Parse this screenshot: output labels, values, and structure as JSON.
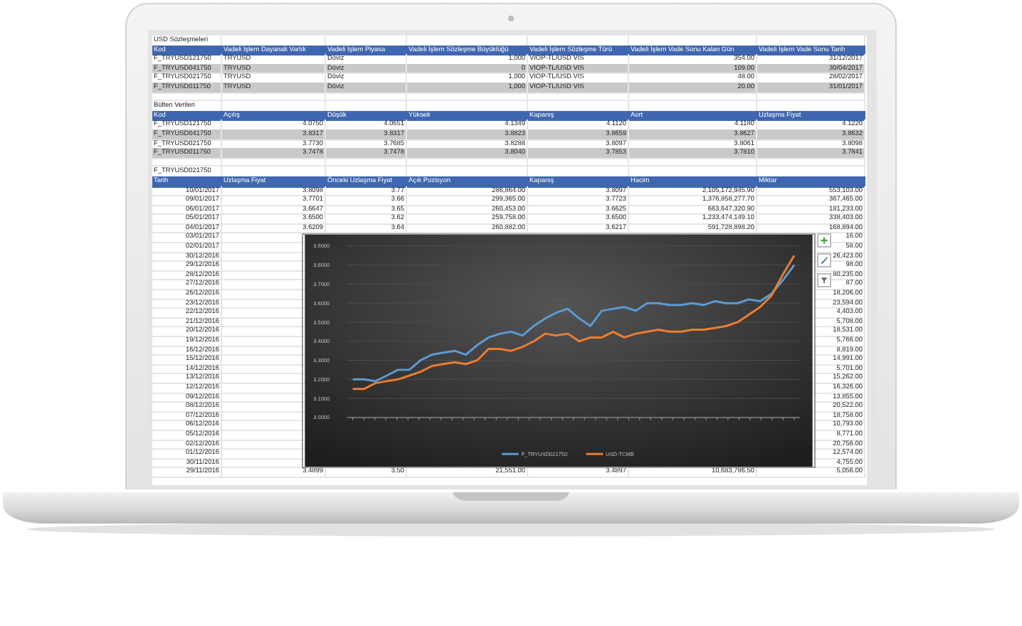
{
  "sheet": {
    "sections": [
      {
        "title": "USD Sözleşmeleri",
        "banded": true,
        "columns": [
          {
            "label": "Kod",
            "kind": "text"
          },
          {
            "label": "Vadeli İşlem Dayanak Varlık",
            "kind": "text"
          },
          {
            "label": "Vadeli İşlem Piyasa",
            "kind": "text"
          },
          {
            "label": "Vadeli İşlem Sözleşme Büyüklüğü",
            "kind": "number"
          },
          {
            "label": "Vadeli İşlem Sözleşme Türü",
            "kind": "text"
          },
          {
            "label": "Vadeli İşlem Vade Sonu Kalan Gün",
            "kind": "number"
          },
          {
            "label": "Vadeli İşlem Vade Sonu Tarih",
            "kind": "number"
          }
        ],
        "rows": [
          [
            "F_TRYUSD121750",
            "TRYUSD",
            "Döviz",
            "1,000",
            "VIOP-TL/USD VIS",
            "354.00",
            "31/12/2017"
          ],
          [
            "F_TRYUSD041750",
            "TRYUSD",
            "Döviz",
            "0",
            "VIOP-TL/USD VIS",
            "109.00",
            "30/04/2017"
          ],
          [
            "F_TRYUSD021750",
            "TRYUSD",
            "Döviz",
            "1,000",
            "VIOP-TL/USD VIS",
            "48.00",
            "28/02/2017"
          ],
          [
            "F_TRYUSD011750",
            "TRYUSD",
            "Döviz",
            "1,000",
            "VIOP-TL/USD VIS",
            "20.00",
            "31/01/2017"
          ]
        ]
      },
      {
        "title": "Bülten Verileri",
        "banded": true,
        "columns": [
          {
            "label": "Kod",
            "kind": "text"
          },
          {
            "label": "Açılış",
            "kind": "number"
          },
          {
            "label": "Düşük",
            "kind": "number"
          },
          {
            "label": "Yüksek",
            "kind": "number"
          },
          {
            "label": "Kapanış",
            "kind": "number"
          },
          {
            "label": "Aort",
            "kind": "number"
          },
          {
            "label": "Uzlaşma Fiyat",
            "kind": "number"
          }
        ],
        "rows": [
          [
            "F_TRYUSD121750",
            "4.0750",
            "4.0651",
            "4.1349",
            "4.1120",
            "4.1180",
            "4.1220"
          ],
          [
            "F_TRYUSD041750",
            "3.8317",
            "3.8317",
            "3.8823",
            "3.8659",
            "3.8627",
            "3.8632"
          ],
          [
            "F_TRYUSD021750",
            "3.7730",
            "3.7685",
            "3.8288",
            "3.8097",
            "3.8061",
            "3.8098"
          ],
          [
            "F_TRYUSD011750",
            "3.7478",
            "3.7478",
            "3.8040",
            "3.7853",
            "3.7810",
            "3.7841"
          ]
        ]
      },
      {
        "title": "F_TRYUSD021750",
        "banded": false,
        "columns": [
          {
            "label": "Tarih",
            "kind": "number"
          },
          {
            "label": "Uzlaşma Fiyat",
            "kind": "number"
          },
          {
            "label": "Önceki Uzlaşma Fiyat",
            "kind": "number"
          },
          {
            "label": "Açık Pozisyon",
            "kind": "number"
          },
          {
            "label": "Kapanış",
            "kind": "number"
          },
          {
            "label": "Hacim",
            "kind": "number"
          },
          {
            "label": "Miktar",
            "kind": "number"
          }
        ],
        "rows": [
          [
            "10/01/2017",
            "3.8098",
            "3.77",
            "286,864.00",
            "3.8097",
            "2,105,172,945.90",
            "553,103.00"
          ],
          [
            "09/01/2017",
            "3.7701",
            "3.66",
            "299,365.00",
            "3.7723",
            "1,376,858,277.70",
            "367,465.00"
          ],
          [
            "06/01/2017",
            "3.6647",
            "3.65",
            "260,453.00",
            "3.6625",
            "663,647,320.90",
            "181,233.00"
          ],
          [
            "05/01/2017",
            "3.6500",
            "3.62",
            "259,758.00",
            "3.6500",
            "1,233,474,149.10",
            "338,403.00"
          ],
          [
            "04/01/2017",
            "3.6209",
            "3.64",
            "260,882.00",
            "3.6217",
            "591,728,898.20",
            "168,894.00"
          ],
          [
            "03/01/2017",
            null,
            null,
            null,
            null,
            null,
            "16.00"
          ],
          [
            "02/01/2017",
            null,
            null,
            null,
            null,
            null,
            "58.00"
          ],
          [
            "30/12/2016",
            null,
            null,
            null,
            null,
            null,
            "26,423.00"
          ],
          [
            "29/12/2016",
            null,
            null,
            null,
            null,
            null,
            "98.00"
          ],
          [
            "28/12/2016",
            null,
            null,
            null,
            null,
            null,
            "80,235.00"
          ],
          [
            "27/12/2016",
            null,
            null,
            null,
            null,
            null,
            "87.00"
          ],
          [
            "26/12/2016",
            null,
            null,
            null,
            null,
            null,
            "18,206.00"
          ],
          [
            "23/12/2016",
            null,
            null,
            null,
            null,
            null,
            "23,594.00"
          ],
          [
            "22/12/2016",
            null,
            null,
            null,
            null,
            null,
            "4,403.00"
          ],
          [
            "21/12/2016",
            null,
            null,
            null,
            null,
            null,
            "5,708.00"
          ],
          [
            "20/12/2016",
            null,
            null,
            null,
            null,
            null,
            "18,531.00"
          ],
          [
            "19/12/2016",
            null,
            null,
            null,
            null,
            null,
            "5,766.00"
          ],
          [
            "16/12/2016",
            null,
            null,
            null,
            null,
            null,
            "8,819.00"
          ],
          [
            "15/12/2016",
            null,
            null,
            null,
            null,
            null,
            "14,991.00"
          ],
          [
            "14/12/2016",
            null,
            null,
            null,
            null,
            null,
            "5,701.00"
          ],
          [
            "13/12/2016",
            null,
            null,
            null,
            null,
            null,
            "15,262.00"
          ],
          [
            "12/12/2016",
            null,
            null,
            null,
            null,
            null,
            "16,326.00"
          ],
          [
            "09/12/2016",
            null,
            null,
            null,
            null,
            null,
            "13,855.00"
          ],
          [
            "08/12/2016",
            null,
            null,
            null,
            null,
            null,
            "20,522.00"
          ],
          [
            "07/12/2016",
            null,
            null,
            null,
            null,
            null,
            "18,758.00"
          ],
          [
            "06/12/2016",
            null,
            null,
            null,
            null,
            null,
            "10,793.00"
          ],
          [
            "05/12/2016",
            null,
            null,
            null,
            null,
            null,
            "8,771.00"
          ],
          [
            "02/12/2016",
            null,
            null,
            null,
            null,
            null,
            "20,756.00"
          ],
          [
            "01/12/2016",
            null,
            null,
            null,
            null,
            null,
            "12,574.00"
          ],
          [
            "30/11/2016",
            null,
            null,
            null,
            null,
            null,
            "4,755.00"
          ],
          [
            "29/11/2016",
            "3.4899",
            "3.50",
            "21,551.00",
            "3.4897",
            "10,683,786.50",
            "5,056.00"
          ]
        ]
      }
    ]
  },
  "chart": {
    "chart_data": {
      "type": "line",
      "ylim": [
        3.0,
        3.9
      ],
      "grid": true,
      "legend": true,
      "yticks": [
        {
          "value": 3.0,
          "label": "3.0000"
        },
        {
          "value": 3.1,
          "label": "3.1000"
        },
        {
          "value": 3.2,
          "label": "3.2000"
        },
        {
          "value": 3.3,
          "label": "3.3000"
        },
        {
          "value": 3.4,
          "label": "3.4000"
        },
        {
          "value": 3.5,
          "label": "3.5000"
        },
        {
          "value": 3.6,
          "label": "3.6000"
        },
        {
          "value": 3.7,
          "label": "3.7000"
        },
        {
          "value": 3.8,
          "label": "3.8000"
        },
        {
          "value": 3.9,
          "label": "3.9000"
        }
      ],
      "series": [
        {
          "name": "F_TRYUSD021750",
          "color": "#5b9bd5",
          "values": [
            3.2,
            3.2,
            3.19,
            3.22,
            3.25,
            3.25,
            3.3,
            3.33,
            3.34,
            3.35,
            3.33,
            3.38,
            3.42,
            3.44,
            3.45,
            3.43,
            3.48,
            3.52,
            3.55,
            3.57,
            3.52,
            3.48,
            3.56,
            3.57,
            3.58,
            3.56,
            3.6,
            3.6,
            3.59,
            3.59,
            3.6,
            3.59,
            3.61,
            3.6,
            3.6,
            3.62,
            3.61,
            3.65,
            3.72,
            3.8
          ]
        },
        {
          "name": "USD-TCMB",
          "color": "#ed7d31",
          "values": [
            3.15,
            3.15,
            3.18,
            3.19,
            3.2,
            3.22,
            3.24,
            3.27,
            3.28,
            3.29,
            3.28,
            3.3,
            3.36,
            3.36,
            3.35,
            3.37,
            3.4,
            3.44,
            3.43,
            3.44,
            3.4,
            3.42,
            3.42,
            3.45,
            3.42,
            3.44,
            3.45,
            3.46,
            3.45,
            3.45,
            3.46,
            3.46,
            3.47,
            3.48,
            3.5,
            3.54,
            3.58,
            3.64,
            3.75,
            3.85
          ]
        }
      ]
    },
    "tools": [
      {
        "kind": "add"
      },
      {
        "kind": "style"
      },
      {
        "kind": "filter"
      }
    ]
  }
}
